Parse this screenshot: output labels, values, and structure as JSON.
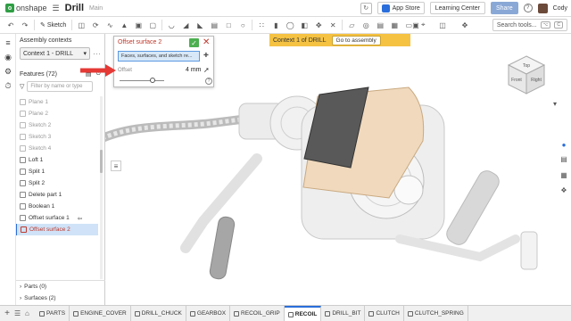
{
  "topbar": {
    "logo_mark": "o",
    "logo_text": "onshape",
    "doc_title": "Drill",
    "workspace": "Main",
    "app_store": "App Store",
    "learning_center": "Learning Center",
    "share": "Share",
    "help": "?",
    "user": "Cody"
  },
  "toolbar": {
    "sketch_label": "Sketch",
    "search_placeholder": "Search tools...",
    "kbd_1": "⌥",
    "kbd_2": "C"
  },
  "panel": {
    "assembly_contexts_label": "Assembly contexts",
    "context_value": "Context 1 - DRILL",
    "features_header": "Features (72)",
    "filter_placeholder": "Filter by name or type",
    "features": [
      {
        "label": "Plane 1",
        "style": "grey"
      },
      {
        "label": "Plane 2",
        "style": "grey"
      },
      {
        "label": "Sketch 2",
        "style": "grey"
      },
      {
        "label": "Sketch 3",
        "style": "grey"
      },
      {
        "label": "Sketch 4",
        "style": "grey"
      },
      {
        "label": "Loft 1",
        "style": "normal"
      },
      {
        "label": "Split 1",
        "style": "normal"
      },
      {
        "label": "Split 2",
        "style": "normal"
      },
      {
        "label": "Delete part 1",
        "style": "normal"
      },
      {
        "label": "Boolean 1",
        "style": "normal"
      },
      {
        "label": "Offset surface 1",
        "style": "normal"
      },
      {
        "label": "Offset surface 2",
        "style": "selected"
      }
    ],
    "parts_label": "Parts (0)",
    "surfaces_label": "Surfaces (2)"
  },
  "dialog": {
    "title": "Offset surface 2",
    "selection_field": "Faces, surfaces, and sketch re...",
    "offset_label": "Offset",
    "offset_value": "4 mm",
    "help": "?"
  },
  "context_banner": {
    "label": "Context 1 of DRILL",
    "goto_button": "Go to assembly"
  },
  "viewcube": {
    "top": "Top",
    "front": "Front",
    "right": "Right"
  },
  "tabs": [
    {
      "label": "PARTS",
      "active": false
    },
    {
      "label": "ENGINE_COVER",
      "active": false
    },
    {
      "label": "DRILL_CHUCK",
      "active": false
    },
    {
      "label": "GEARBOX",
      "active": false
    },
    {
      "label": "RECOIL_GRIP",
      "active": false
    },
    {
      "label": "RECOIL",
      "active": true
    },
    {
      "label": "DRILL_BIT",
      "active": false
    },
    {
      "label": "CLUTCH",
      "active": false
    },
    {
      "label": "CLUTCH_SPRING",
      "active": false
    }
  ],
  "colors": {
    "accent_blue": "#2a6edb",
    "selection_red": "#c0392b",
    "banner_yellow": "#f5c242",
    "highlight_face": "#595959",
    "highlight_part": "#f0d9bd"
  }
}
